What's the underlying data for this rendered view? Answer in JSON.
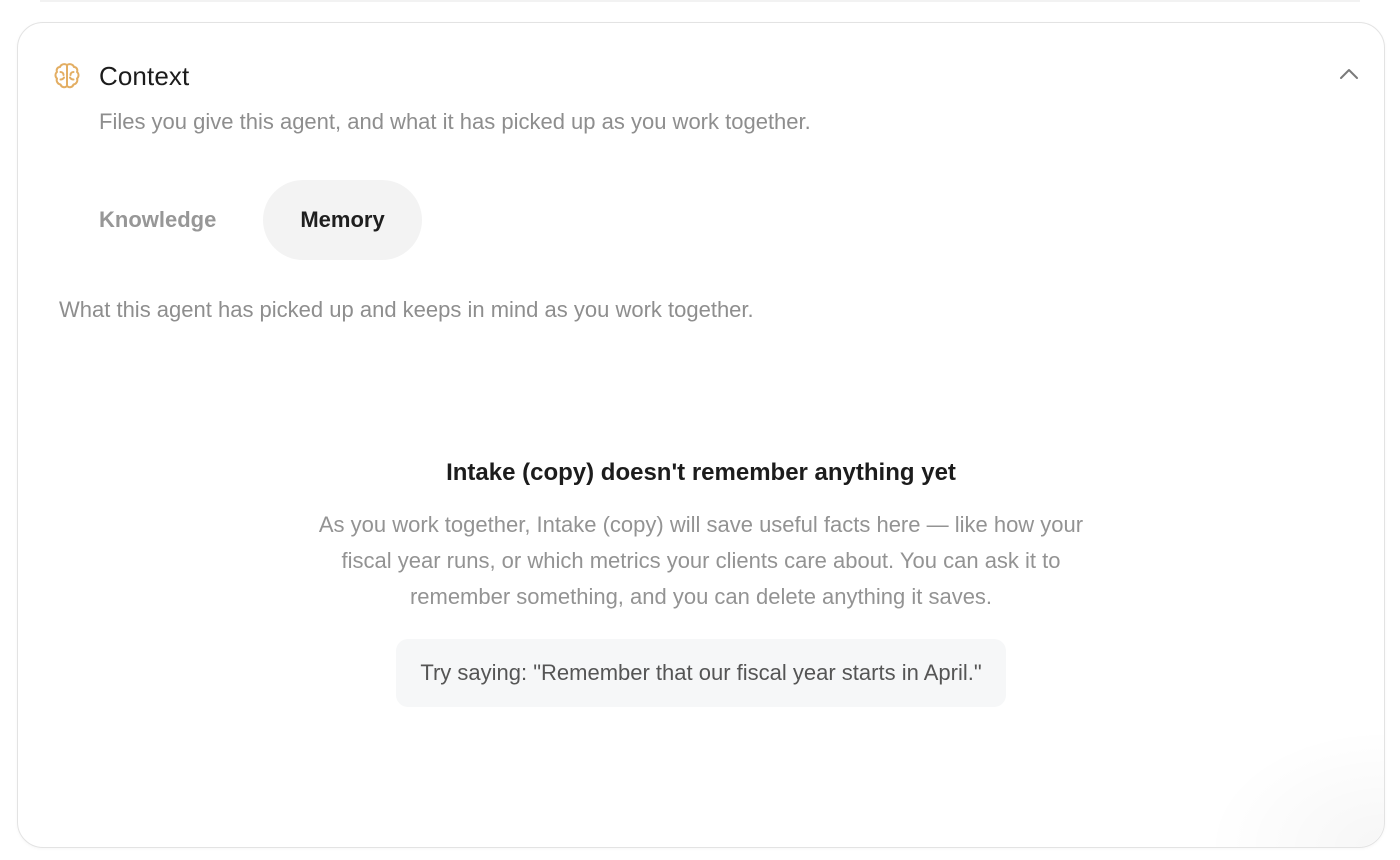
{
  "context": {
    "icon": "brain-icon",
    "accent_color": "#E3AE63",
    "title": "Context",
    "subtitle": "Files you give this agent, and what it has picked up as you work together.",
    "collapse_icon": "chevron-up-icon"
  },
  "tabs": [
    {
      "label": "Knowledge",
      "active": false
    },
    {
      "label": "Memory",
      "active": true
    }
  ],
  "memory": {
    "description": "What this agent has picked up and keeps in mind as you work together.",
    "empty_title": "Intake (copy) doesn't remember anything yet",
    "empty_body": "As you work together, Intake (copy) will save useful facts here — like how your fiscal year runs, or which metrics your clients care about. You can ask it to remember something, and you can delete anything it saves.",
    "hint": "Try saying: \"Remember that our fiscal year starts in April.\""
  }
}
